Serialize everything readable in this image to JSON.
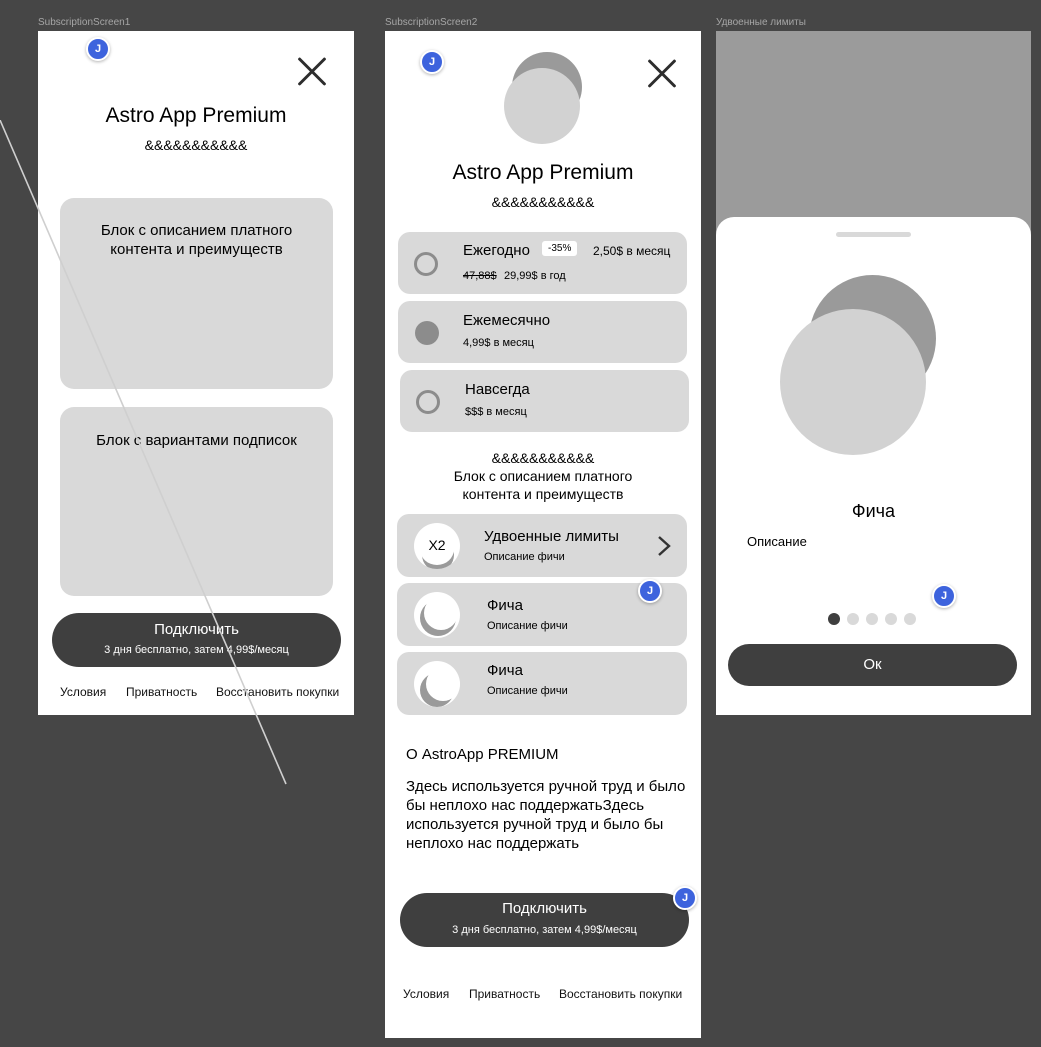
{
  "colors": {
    "canvas": "#464646",
    "frame": "#ffffff",
    "block": "#d9d9d9",
    "dark": "#3f3f3f",
    "avatar": "#3d63dd"
  },
  "frames": {
    "screen1": "SubscriptionScreen1",
    "screen2": "SubscriptionScreen2",
    "screen3": "Удвоенные лимиты"
  },
  "avatar_initial": "J",
  "screen1": {
    "title": "Astro App Premium",
    "subtitle": "&&&&&&&&&&&",
    "block1": "Блок с описанием платного контента и преимуществ",
    "block2": "Блок с вариантами подписок",
    "cta_label": "Подключить",
    "cta_sub": "3 дня бесплатно, затем 4,99$/месяц",
    "footer": {
      "terms": "Условия",
      "privacy": "Приватность",
      "restore": "Восстановить покупки"
    }
  },
  "screen2": {
    "title": "Astro App Premium",
    "subtitle": "&&&&&&&&&&&",
    "plans": [
      {
        "name": "Ежегодно",
        "badge": "-35%",
        "per_month": "2,50$ в месяц",
        "old_price": "47,88$",
        "price": "29,99$ в год",
        "selected": false
      },
      {
        "name": "Ежемесячно",
        "price": "4,99$ в месяц",
        "selected": true
      },
      {
        "name": "Навсегда",
        "price": "$$$ в месяц",
        "selected": false
      }
    ],
    "desc_line1": "&&&&&&&&&&&",
    "desc_line2": "Блок с описанием платного",
    "desc_line3": "контента и преимуществ",
    "features": [
      {
        "icon_text": "X2",
        "title": "Удвоенные лимиты",
        "desc": "Описание фичи"
      },
      {
        "icon_text": "",
        "title": "Фича",
        "desc": "Описание фичи"
      },
      {
        "icon_text": "",
        "title": "Фича",
        "desc": "Описание фичи"
      }
    ],
    "about_title": "О AstroApp PREMIUM",
    "about_text": "Здесь используется ручной труд и было бы неплохо нас поддержатьЗдесь используется ручной труд и было бы неплохо нас поддержать",
    "cta_label": "Подключить",
    "cta_sub": "3 дня бесплатно, затем 4,99$/месяц",
    "footer": {
      "terms": "Условия",
      "privacy": "Приватность",
      "restore": "Восстановить покупки"
    }
  },
  "screen3": {
    "feature_title": "Фича",
    "feature_desc": "Описание",
    "pager": {
      "count": 5,
      "active": 0
    },
    "ok_label": "Ок"
  }
}
